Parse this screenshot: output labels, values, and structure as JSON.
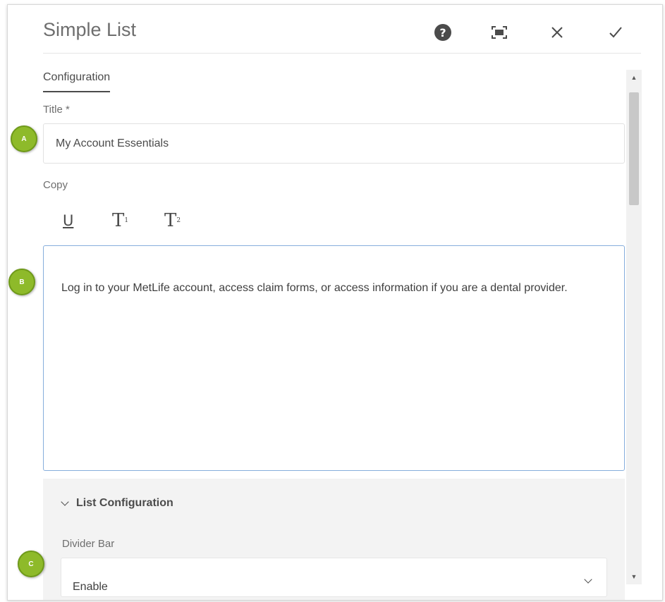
{
  "dialog": {
    "title": "Simple List",
    "buttons": {
      "help_icon": "help-icon",
      "fullscreen_icon": "fullscreen-icon",
      "close_icon": "close-icon",
      "done_icon": "checkmark-icon"
    }
  },
  "tabs": [
    {
      "label": "Configuration",
      "active": true
    }
  ],
  "form": {
    "title_label": "Title *",
    "title_value": "My Account Essentials",
    "copy_label": "Copy",
    "rte_toolbar": {
      "underline": "U",
      "subscript": "T",
      "subscript_mark": "1",
      "superscript": "T",
      "superscript_mark": "2"
    },
    "copy_text": "Log in to your MetLife account, access claim forms, or access information if you are a dental provider."
  },
  "list_configuration": {
    "heading": "List Configuration",
    "divider_bar_label": "Divider Bar",
    "divider_bar_value": "Enable"
  },
  "markers": {
    "a": "A",
    "b": "B",
    "c": "C",
    "color": "#8eba2a"
  },
  "colors": {
    "focus_border": "#86aedc",
    "section_bg": "#f3f3f3",
    "text": "#4b4b4b"
  }
}
